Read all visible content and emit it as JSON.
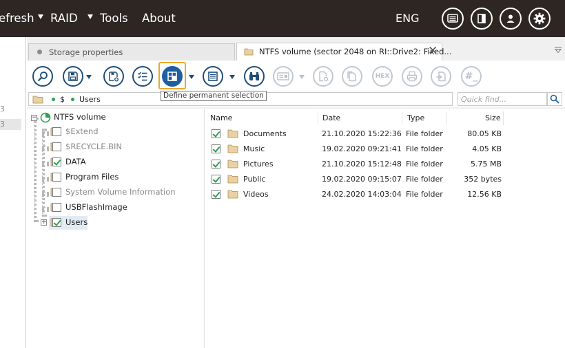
{
  "menu": {
    "refresh": "efresh",
    "raid": "RAID",
    "tools": "Tools",
    "about": "About",
    "language": "ENG"
  },
  "left_strip": {
    "item1": "3",
    "item2": "3"
  },
  "tabs": [
    {
      "label": "Storage properties"
    },
    {
      "label": "NTFS volume (sector 2048 on RI::Drive2: Fixed..."
    }
  ],
  "toolbar": {
    "tooltip": "Define permanent selection",
    "hex_label": "HEX",
    "hash_label": "#_"
  },
  "path": {
    "segments": [
      "$",
      "Users"
    ]
  },
  "search": {
    "placeholder": "Quick find..."
  },
  "tree": {
    "root": "NTFS volume",
    "items": [
      {
        "label": "$Extend",
        "checked": false,
        "dim": true
      },
      {
        "label": "$RECYCLE.BIN",
        "checked": false,
        "dim": true
      },
      {
        "label": "DATA",
        "checked": true,
        "dim": false
      },
      {
        "label": "Program Files",
        "checked": false,
        "dim": false
      },
      {
        "label": "System Volume Information",
        "checked": false,
        "dim": true
      },
      {
        "label": "USBFlashImage",
        "checked": false,
        "dim": false
      },
      {
        "label": "Users",
        "checked": true,
        "dim": false
      }
    ]
  },
  "list": {
    "columns": [
      "Name",
      "Date",
      "Type",
      "Size"
    ],
    "rows": [
      {
        "name": "Documents",
        "date": "21.10.2020 15:22:36",
        "type": "File folder",
        "size": "80.05 KB"
      },
      {
        "name": "Music",
        "date": "19.02.2020 09:21:41",
        "type": "File folder",
        "size": "4.05 KB"
      },
      {
        "name": "Pictures",
        "date": "21.10.2020 15:12:48",
        "type": "File folder",
        "size": "5.75 MB"
      },
      {
        "name": "Public",
        "date": "19.02.2020 09:15:07",
        "type": "File folder",
        "size": "352 bytes"
      },
      {
        "name": "Videos",
        "date": "24.02.2020 14:03:04",
        "type": "File folder",
        "size": "12.56 KB"
      }
    ]
  },
  "colors": {
    "topbar": "#2e2622",
    "accent": "#1f4e79",
    "selection_frame": "#e8a92e",
    "check": "#2aa14f"
  }
}
